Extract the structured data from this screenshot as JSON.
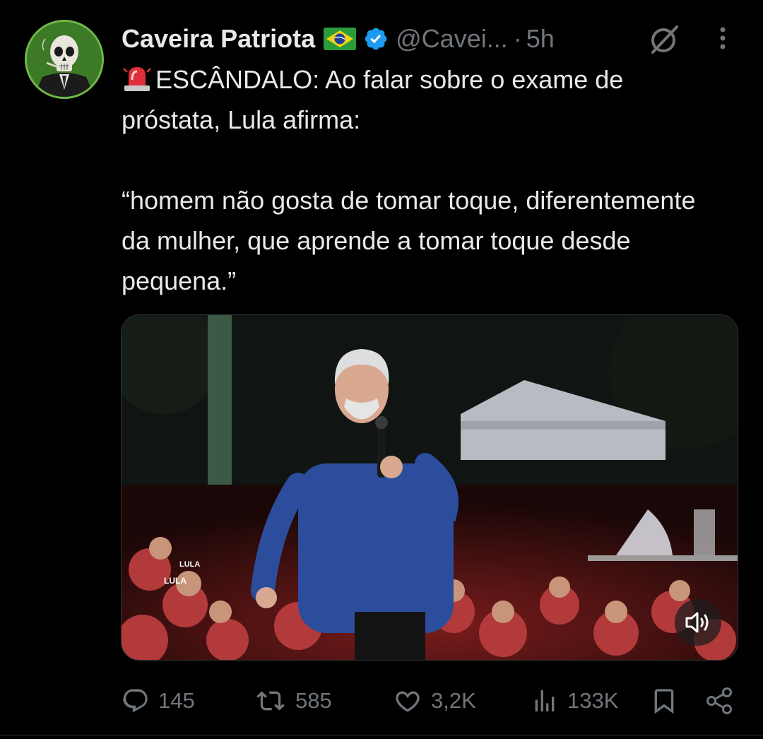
{
  "author": {
    "display_name": "Caveira Patriota",
    "flag_icon": "brazil-flag-icon",
    "verified": true,
    "handle": "@Cavei...",
    "separator": "·",
    "timestamp": "5h"
  },
  "tweet": {
    "line1": "ESCÂNDALO: Ao falar sobre o exame de próstata, Lula afirma:",
    "quote": "“homem não gosta de tomar toque, diferentemente da mulher, que aprende a tomar toque desde pequena.”",
    "leading_icon": "siren-icon"
  },
  "media": {
    "type": "video",
    "sign_text": "LULA",
    "mute_icon": "volume-icon"
  },
  "actions": {
    "replies": "145",
    "retweets": "585",
    "likes": "3,2K",
    "views": "133K"
  },
  "colors": {
    "background": "#000000",
    "text": "#e7e9ea",
    "muted": "#71767b",
    "verified": "#1d9bf0"
  }
}
